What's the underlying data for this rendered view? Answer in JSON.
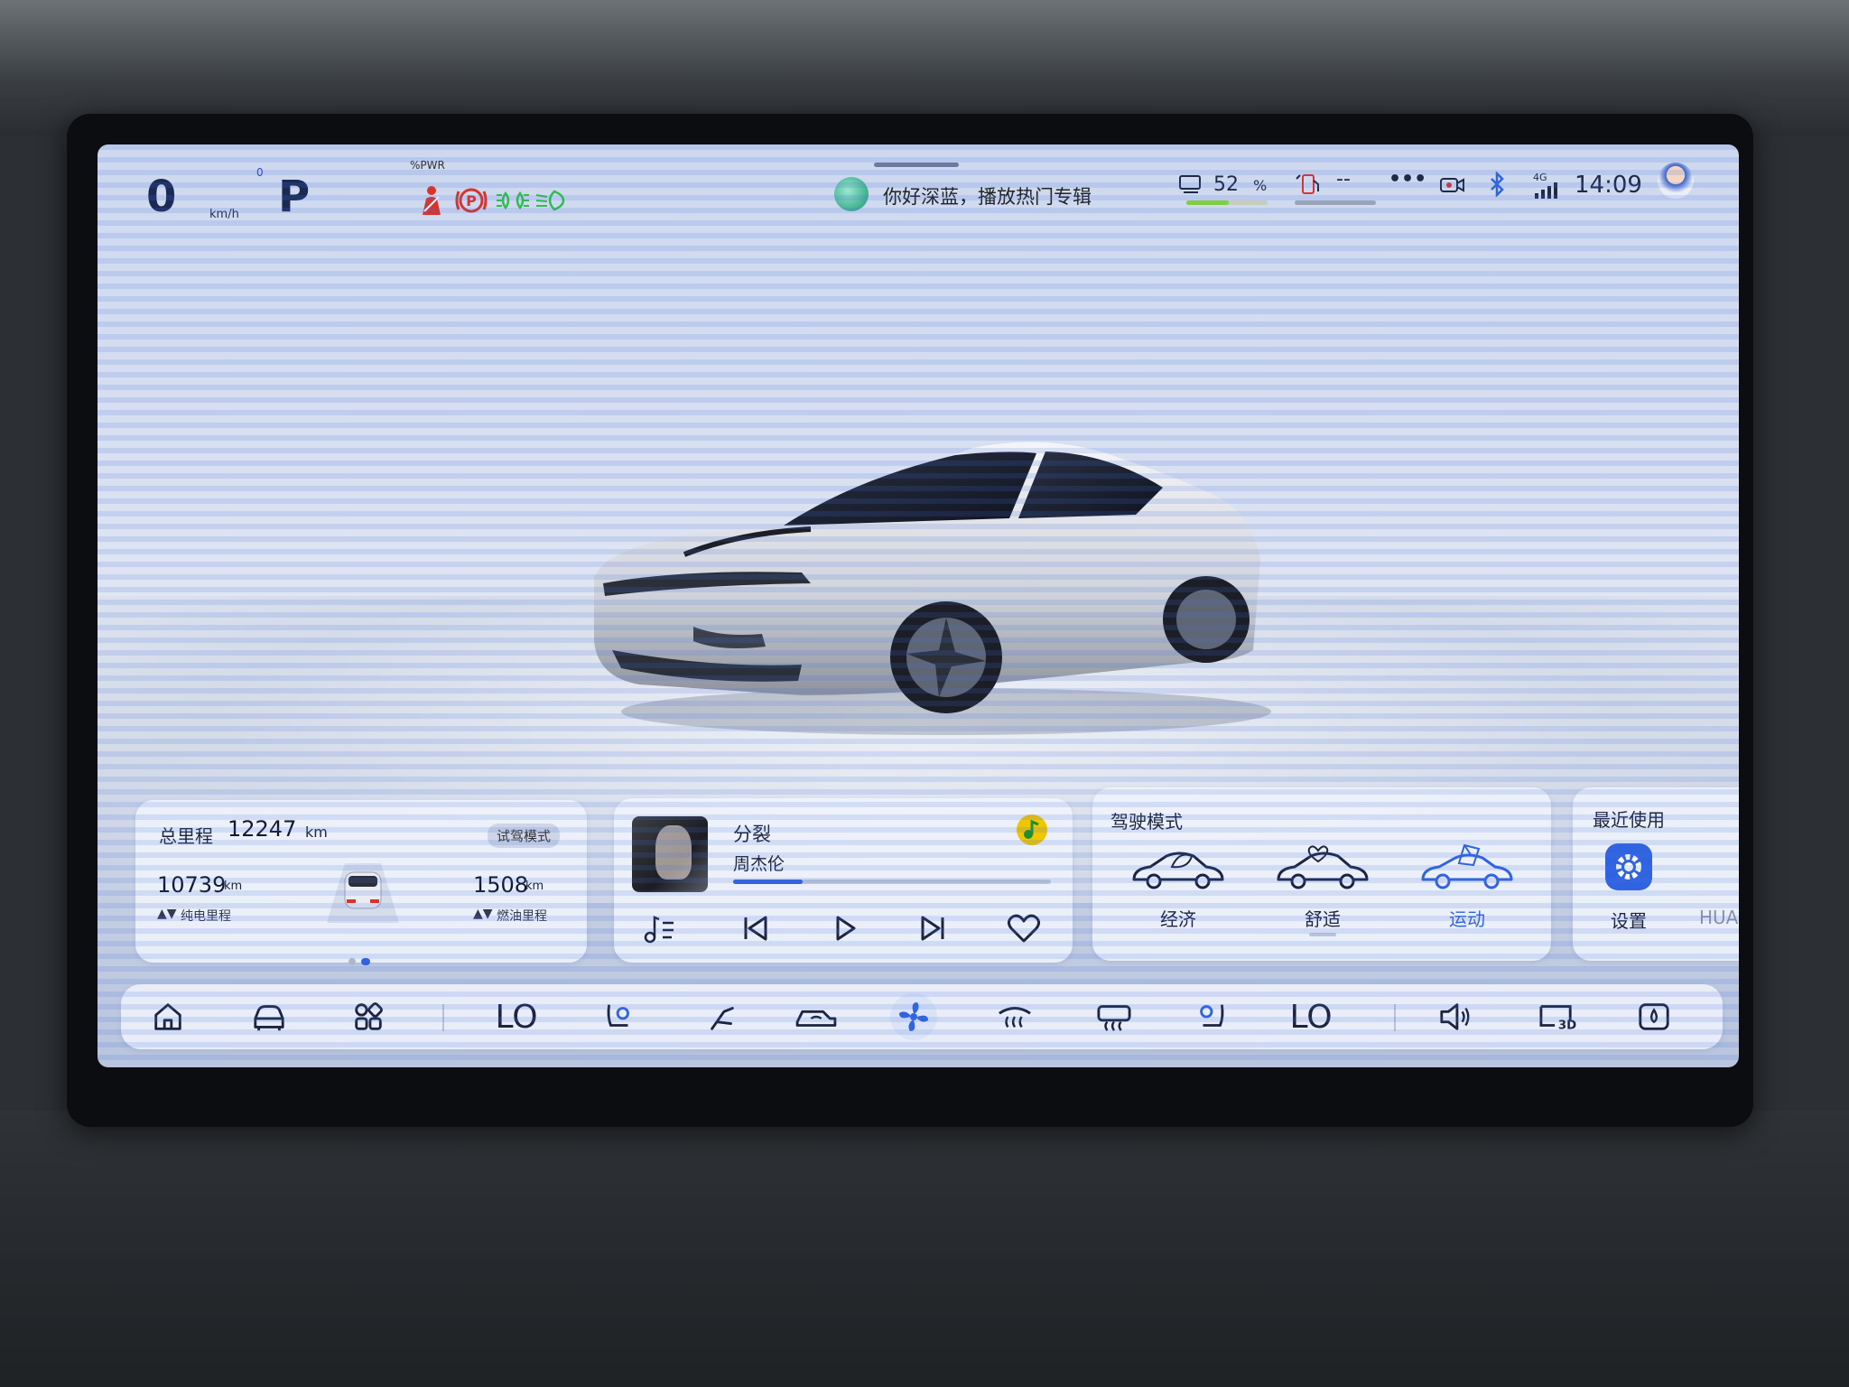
{
  "status_bar": {
    "speed": "0",
    "speed_unit": "km/h",
    "gear_indicator": "0",
    "gear": "P",
    "power_label": "%PWR",
    "assistant_greeting": "你好深蓝，播放热门专辑",
    "battery_percent": "52",
    "battery_unit": "%",
    "fuel_value": "--",
    "more": "•••",
    "network": "4G",
    "time": "14:09"
  },
  "mileage_card": {
    "total_label": "总里程",
    "total_value": "12247",
    "total_unit": "km",
    "mode_tag": "试驾模式",
    "ev_value": "10739",
    "ev_unit": "km",
    "ev_label": "纯电里程",
    "fuel_range_value": "1508",
    "fuel_range_unit": "km",
    "fuel_range_label": "燃油里程",
    "page_dots": 2,
    "active_page": 1
  },
  "music_card": {
    "song_title": "分裂",
    "artist": "周杰伦",
    "progress": 0.22
  },
  "drive_mode_card": {
    "title": "驾驶模式",
    "modes": [
      {
        "label": "经济",
        "selected": false
      },
      {
        "label": "舒适",
        "selected": false
      },
      {
        "label": "运动",
        "selected": true
      }
    ]
  },
  "recent_card": {
    "title": "最近使用",
    "app_label": "设置",
    "next_app_label": "HUA"
  },
  "dock": {
    "left_temp": "LO",
    "right_temp": "LO"
  },
  "colors": {
    "accent": "#2f63e0",
    "text_dark": "#1c2440",
    "warning_red": "#d8342c",
    "indicator_green": "#2fbf4a"
  }
}
